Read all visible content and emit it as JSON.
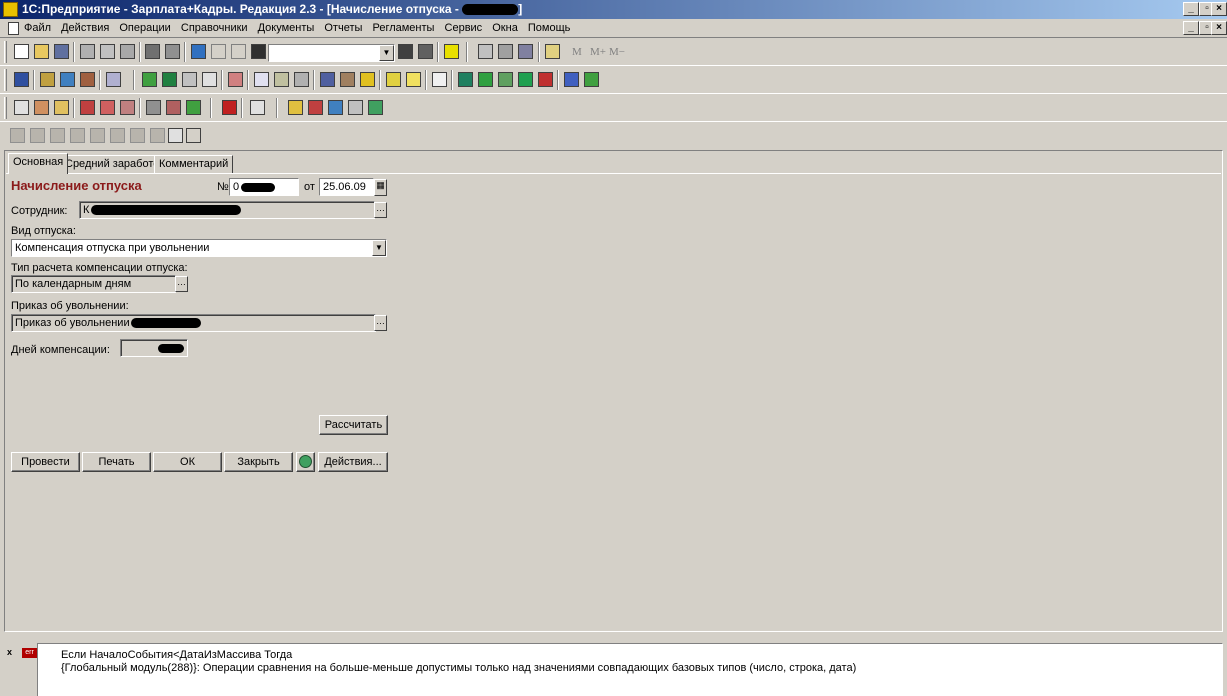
{
  "window": {
    "title": "1С:Предприятие - Зарплата+Кадры. Редакция 2.3 - [Начисление отпуска - ",
    "controls": [
      "_",
      "▫",
      "×"
    ]
  },
  "menu": [
    "Файл",
    "Действия",
    "Операции",
    "Справочники",
    "Документы",
    "Отчеты",
    "Регламенты",
    "Сервис",
    "Окна",
    "Помощь"
  ],
  "toolbar": {
    "search_value": "",
    "memory_buttons": [
      "M",
      "M+",
      "M−"
    ]
  },
  "tabs": [
    "Основная",
    "Средний заработок",
    "Комментарий"
  ],
  "form": {
    "title": "Начисление отпуска",
    "number_label": "№",
    "number_value": "0",
    "date_label": "от",
    "date_value": "25.06.09",
    "employee_label": "Сотрудник:",
    "employee_value": "К",
    "vacation_type_label": "Вид отпуска:",
    "vacation_type_value": "Компенсация отпуска при увольнении",
    "calc_type_label": "Тип расчета компенсации отпуска:",
    "calc_type_value": "По календарным дням",
    "order_label": "Приказ об увольнении:",
    "order_value": "Приказ об увольнении",
    "days_label": "Дней компенсации:",
    "days_value": ""
  },
  "buttons": {
    "calculate": "Рассчитать",
    "post": "Провести",
    "print": "Печать",
    "ok": "ОК",
    "close": "Закрыть",
    "actions": "Действия..."
  },
  "messages": {
    "close_label": "x",
    "icon_label": "err",
    "line1": "Если НачалоСобытия<ДатаИзМассива Тогда",
    "line2": "{Глобальный модуль(288)}: Операции сравнения на больше-меньше допустимы только над значениями совпадающих базовых типов (число, строка, дата)"
  },
  "colors": {
    "title_bar_start": "#0a246a",
    "title_bar_end": "#a6caf0",
    "document_title": "#8b1a1a",
    "window_bg": "#d4d0c8"
  }
}
